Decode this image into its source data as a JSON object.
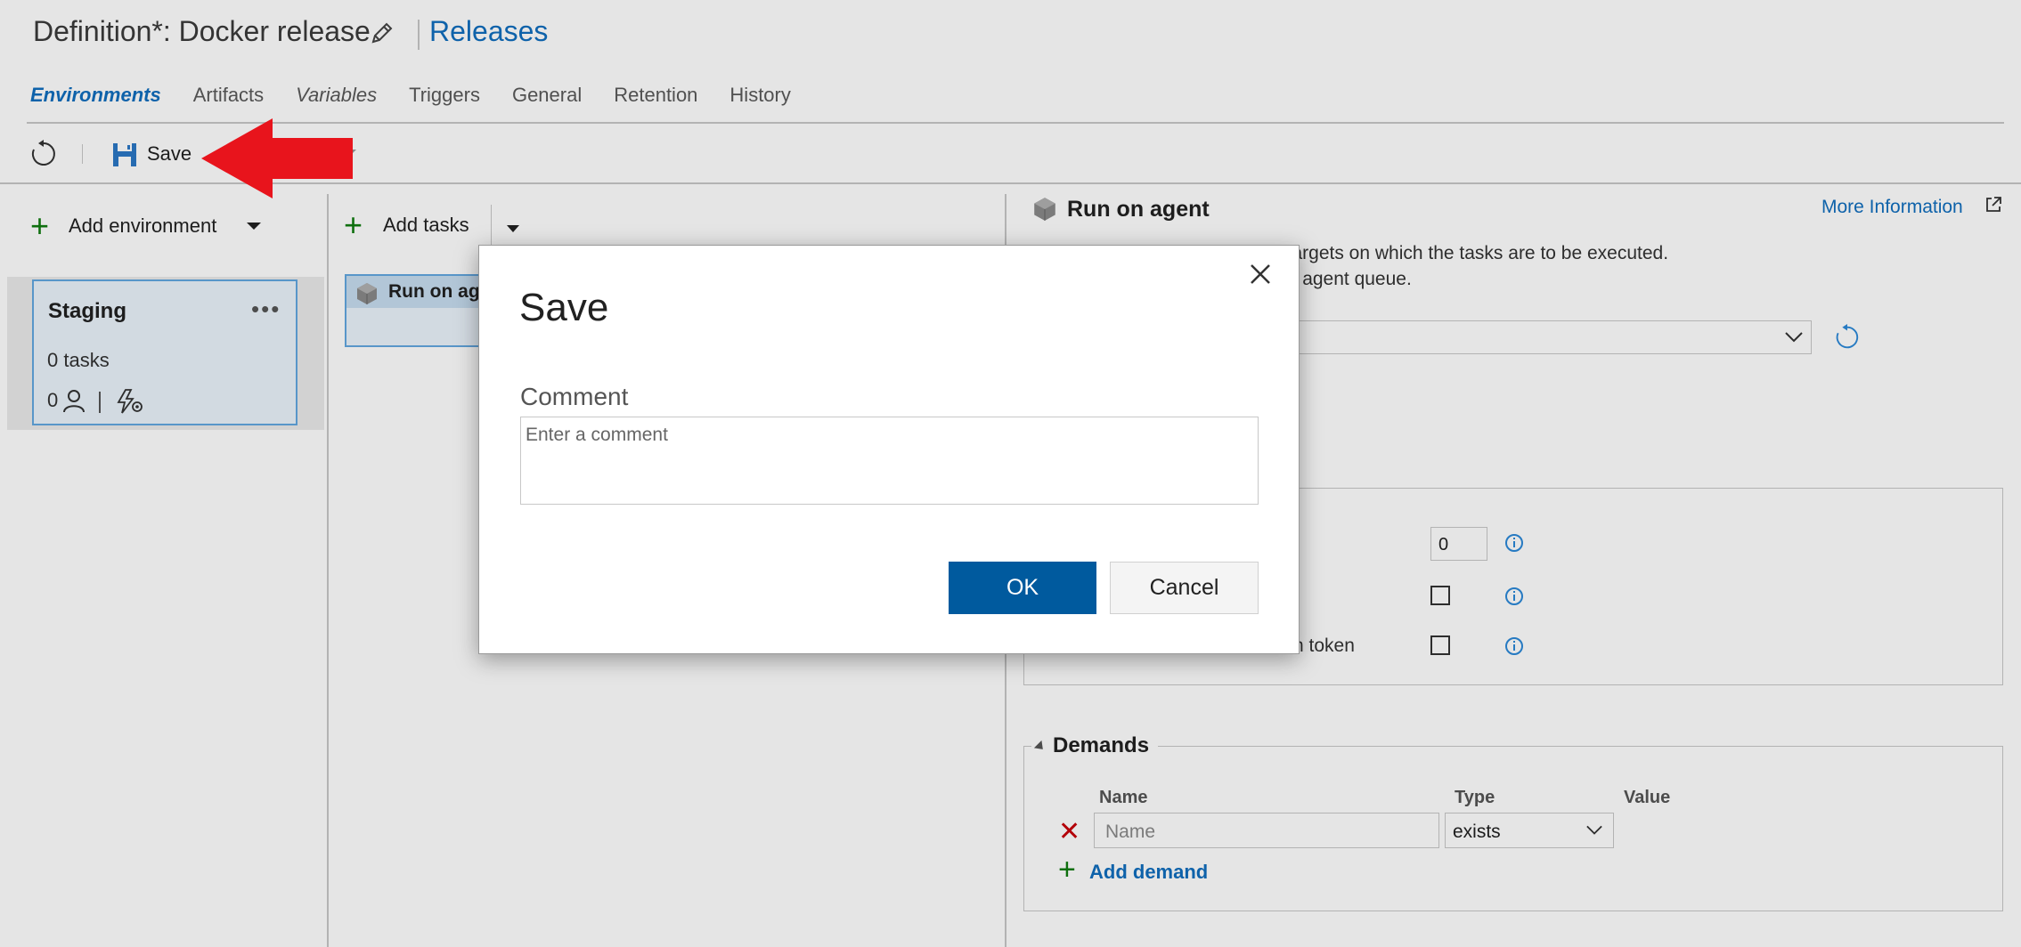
{
  "header": {
    "definition_title": "Definition*: Docker release",
    "releases_link": "Releases"
  },
  "tabs": [
    {
      "label": "Environments",
      "active": true
    },
    {
      "label": "Artifacts"
    },
    {
      "label": "Variables"
    },
    {
      "label": "Triggers"
    },
    {
      "label": "General"
    },
    {
      "label": "Retention"
    },
    {
      "label": "History"
    }
  ],
  "toolbar": {
    "save_label": "Save"
  },
  "environments": {
    "add_label": "Add environment",
    "card": {
      "name": "Staging",
      "tasks": "0 tasks",
      "approvers_count": "0"
    }
  },
  "tasks_panel": {
    "add_label": "Add tasks",
    "phase_label": "Run on agent"
  },
  "agent_panel": {
    "title": "Run on agent",
    "more_info": "More Information",
    "desc_line1": "sks, they define the runtime targets on which the tasks are to be executed.",
    "desc_line2": "set of tasks on an agent in an agent queue.",
    "options": {
      "number_value": "0",
      "token_label": "h token"
    },
    "demands": {
      "title": "Demands",
      "col_name": "Name",
      "col_type": "Type",
      "col_value": "Value",
      "name_placeholder": "Name",
      "type_value": "exists",
      "add_label": "Add demand"
    }
  },
  "dialog": {
    "title": "Save",
    "comment_label": "Comment",
    "comment_placeholder": "Enter a comment",
    "ok_label": "OK",
    "cancel_label": "Cancel"
  },
  "colors": {
    "accent": "#106ebe",
    "primary_button": "#005a9e",
    "add_green": "#107c10",
    "annotation_arrow": "#e8141c"
  }
}
